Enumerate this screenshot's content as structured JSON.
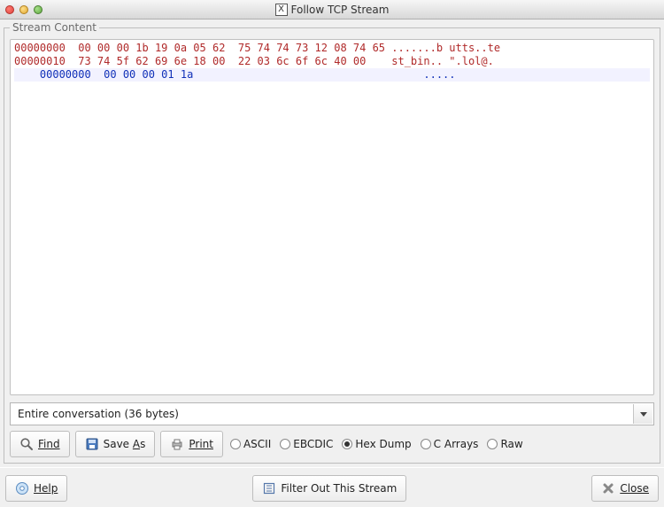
{
  "window": {
    "title": "Follow TCP Stream"
  },
  "panel": {
    "legend": "Stream Content",
    "hex": {
      "red1": "00000000  00 00 00 1b 19 0a 05 62  75 74 74 73 12 08 74 65 .......b utts..te",
      "red2": "00000010  73 74 5f 62 69 6e 18 00  22 03 6c 6f 6c 40 00    st_bin.. \".lol@.",
      "blue": "    00000000  00 00 00 01 1a                                    ....."
    },
    "combo_label": "Entire conversation (36 bytes)"
  },
  "buttons": {
    "find": "Find",
    "save_as_pre": "Save ",
    "save_as_ul": "A",
    "save_as_post": "s",
    "print": "Print",
    "help": "Help",
    "filter_out": "Filter Out This Stream",
    "close": "Close"
  },
  "radios": {
    "ascii": "ASCII",
    "ebcdic": "EBCDIC",
    "hexdump": "Hex Dump",
    "carrays": "C Arrays",
    "raw": "Raw"
  }
}
